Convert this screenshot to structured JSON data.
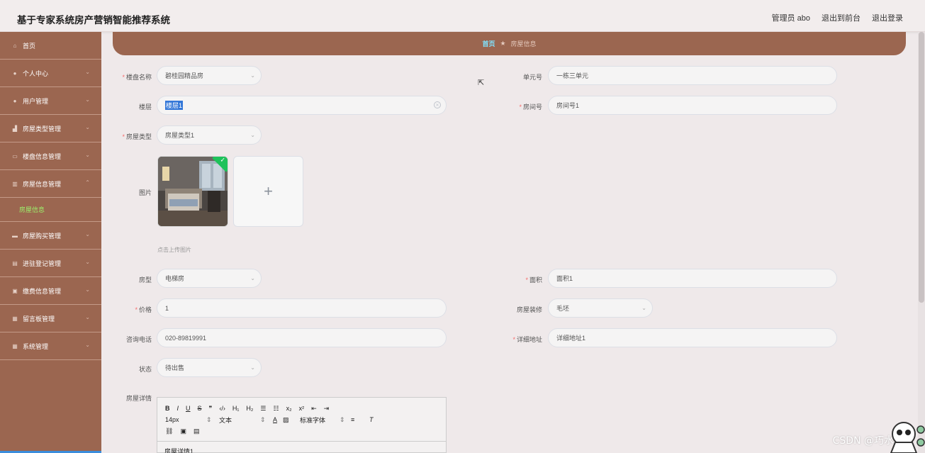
{
  "header": {
    "title": "基于专家系统房产营销智能推荐系统",
    "links": [
      "管理员 abo",
      "退出到前台",
      "退出登录"
    ]
  },
  "sidebar": {
    "items": [
      {
        "label": "首页",
        "icon": "home-icon"
      },
      {
        "label": "个人中心",
        "icon": "user-icon"
      },
      {
        "label": "用户管理",
        "icon": "user-icon"
      },
      {
        "label": "房屋类型管理",
        "icon": "chart-icon"
      },
      {
        "label": "楼盘信息管理",
        "icon": "card-icon"
      },
      {
        "label": "房屋信息管理",
        "icon": "bars-icon"
      },
      {
        "label": "房屋购买管理",
        "icon": "monitor-icon"
      },
      {
        "label": "进驻登记管理",
        "icon": "briefcase-icon"
      },
      {
        "label": "缴费信息管理",
        "icon": "wallet-icon"
      },
      {
        "label": "留言板管理",
        "icon": "trash-icon"
      },
      {
        "label": "系统管理",
        "icon": "grid-icon"
      }
    ],
    "submenu_label": "房屋信息"
  },
  "breadcrumb": {
    "home": "首页",
    "sep": "★",
    "current": "房屋信息"
  },
  "form": {
    "loupan_label": "楼盘名称",
    "loupan_value": "碧桂园精品房",
    "danyuan_label": "单元号",
    "danyuan_value": "一栋三单元",
    "louceng_label": "楼层",
    "louceng_value": "楼层1",
    "fangjian_label": "房间号",
    "fangjian_value": "房间号1",
    "fangwuleixing_label": "房屋类型",
    "fangwuleixing_value": "房屋类型1",
    "tupian_label": "图片",
    "upload_hint": "点击上传图片",
    "upload_plus": "+",
    "huxing_label": "房型",
    "huxing_value": "电梯房",
    "mianji_label": "面积",
    "mianji_value": "面积1",
    "jiage_label": "价格",
    "jiage_value": "1",
    "zhuangxiu_label": "房屋装修",
    "zhuangxiu_value": "毛坯",
    "dianhua_label": "咨询电话",
    "dianhua_value": "020-89819991",
    "dizhi_label": "详细地址",
    "dizhi_value": "详细地址1",
    "zhuangtai_label": "状态",
    "zhuangtai_value": "待出售",
    "xiangqing_label": "房屋详情"
  },
  "editor": {
    "row1": [
      "B",
      "I",
      "U",
      "S",
      "❞",
      "‹/›",
      "H₁",
      "H₂",
      "☰",
      "☷",
      "x₂",
      "x²",
      "⇤",
      "⇥"
    ],
    "font_size": "14px",
    "text_type": "文本",
    "font_family": "标准字体",
    "content": "房屋详情1"
  },
  "watermark": "CSDN @巧水科技",
  "colors": {
    "sidebar": "#9b6650",
    "accent_link": "#7fe3ff",
    "active_sub": "#9cf26b"
  }
}
